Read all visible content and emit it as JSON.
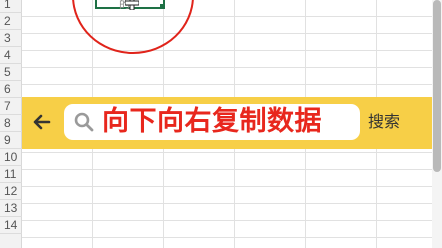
{
  "spreadsheet": {
    "row_numbers": [
      "1",
      "2",
      "3",
      "4",
      "5",
      "6",
      "7",
      "8",
      "9",
      "10",
      "11",
      "12",
      "13",
      "14"
    ],
    "selected_cell_fragment": "的",
    "accent_color": "#1e7145"
  },
  "annotation": {
    "circle_color": "#e0241b"
  },
  "search_bar": {
    "background_color": "#f7cf47",
    "back_icon": "arrow-left-icon",
    "search_icon": "search-icon",
    "query": "向下向右复制数据",
    "query_color": "#e8271d",
    "search_button_label": "搜索"
  }
}
